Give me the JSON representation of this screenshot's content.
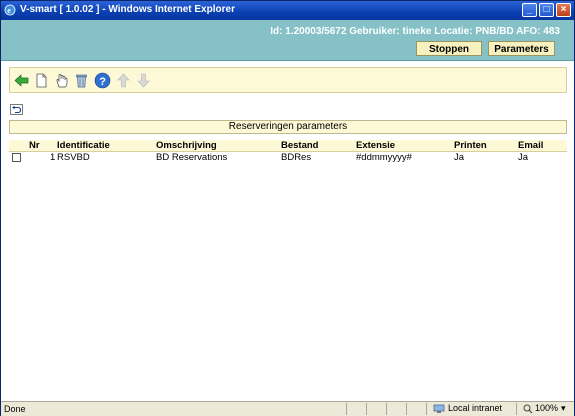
{
  "window": {
    "title": "V-smart [ 1.0.02 ] - Windows Internet Explorer"
  },
  "header": {
    "info": "Id: 1.20003/5672   Gebruiker: tineke   Locatie: PNB/BD   AFO: 483",
    "stop_label": "Stoppen",
    "params_label": "Parameters"
  },
  "toolbar": {
    "icons": [
      "back-arrow-icon",
      "new-document-icon",
      "hand-select-icon",
      "trash-icon",
      "help-icon",
      "up-arrow-icon",
      "down-arrow-icon"
    ]
  },
  "caption": "Reserveringen parameters",
  "table": {
    "columns": [
      "Nr",
      "Identificatie",
      "Omschrijving",
      "Bestand",
      "Extensie",
      "Printen",
      "Email"
    ],
    "rows": [
      {
        "nr": "1",
        "identificatie": "RSVBD",
        "omschrijving": "BD Reservations",
        "bestand": "BDRes",
        "extensie": "#ddmmyyyy#",
        "printen": "Ja",
        "email": "Ja"
      }
    ]
  },
  "status": {
    "left": "Done",
    "zone": "Local intranet",
    "zoom": "100%"
  },
  "colors": {
    "header": "#85c1c6",
    "panel": "#fdf8d6",
    "title": "#0a3fb0"
  }
}
